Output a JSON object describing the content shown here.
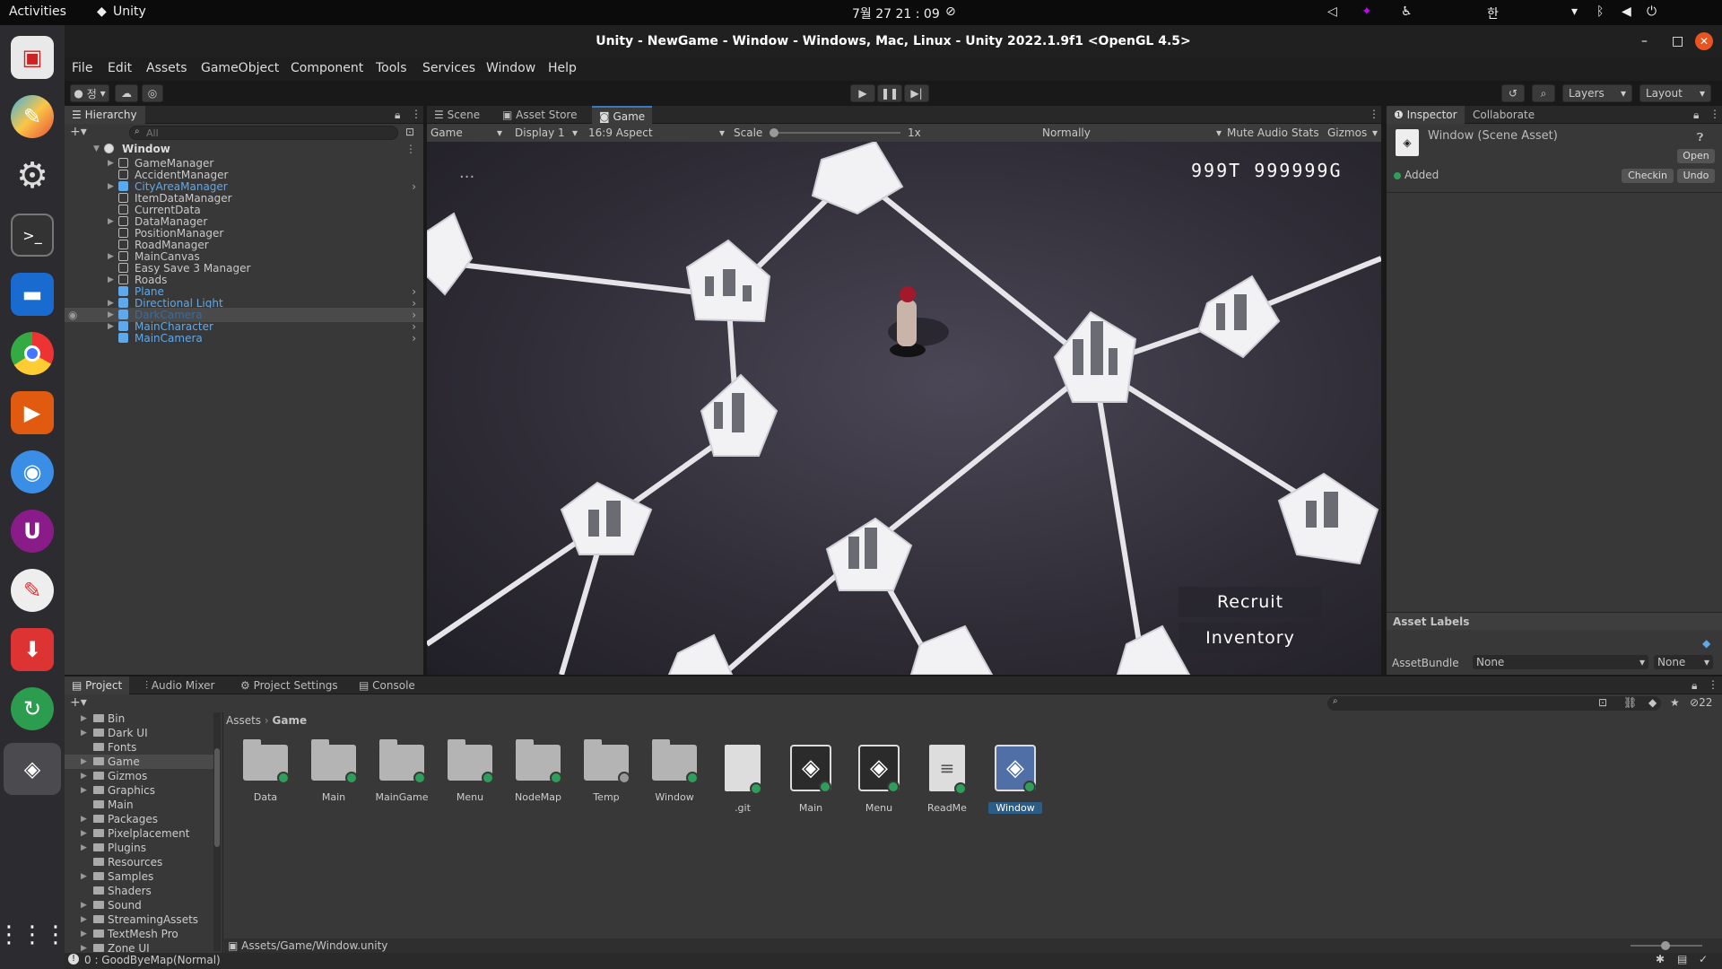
{
  "topbar": {
    "activities": "Activities",
    "app": "Unity",
    "clock": "7월 27 21 : 09",
    "ime": "한"
  },
  "window": {
    "title": "Unity - NewGame - Window - Windows, Mac, Linux - Unity 2022.1.9f1 <OpenGL 4.5>"
  },
  "menu": [
    "File",
    "Edit",
    "Assets",
    "GameObject",
    "Component",
    "Tools",
    "Services",
    "Window",
    "Help"
  ],
  "toolbar": {
    "account": "정",
    "layers": "Layers",
    "layout": "Layout"
  },
  "hierarchy": {
    "tab": "Hierarchy",
    "search_placeholder": "All",
    "root": "Window",
    "items": [
      {
        "label": "GameManager",
        "prefab": false,
        "arrow": true
      },
      {
        "label": "AccidentManager",
        "prefab": false,
        "arrow": false
      },
      {
        "label": "CityAreaManager",
        "prefab": true,
        "arrow": true
      },
      {
        "label": "ItemDataManager",
        "prefab": false,
        "arrow": false
      },
      {
        "label": "CurrentData",
        "prefab": false,
        "arrow": false
      },
      {
        "label": "DataManager",
        "prefab": false,
        "arrow": true
      },
      {
        "label": "PositionManager",
        "prefab": false,
        "arrow": false
      },
      {
        "label": "RoadManager",
        "prefab": false,
        "arrow": false
      },
      {
        "label": "MainCanvas",
        "prefab": false,
        "arrow": true
      },
      {
        "label": "Easy Save 3 Manager",
        "prefab": false,
        "arrow": false
      },
      {
        "label": "Roads",
        "prefab": false,
        "arrow": true
      },
      {
        "label": "Plane",
        "prefab": true,
        "arrow": false
      },
      {
        "label": "Directional Light",
        "prefab": true,
        "arrow": true
      },
      {
        "label": "DarkCamera",
        "prefab": true,
        "arrow": true,
        "selected": true,
        "dim": true
      },
      {
        "label": "MainCharacter",
        "prefab": true,
        "arrow": true
      },
      {
        "label": "MainCamera",
        "prefab": true,
        "arrow": false
      }
    ]
  },
  "scene": {
    "tabs": [
      "Scene",
      "Asset Store",
      "Game"
    ],
    "active_tab": "Game",
    "display_mode": "Game",
    "display": "Display 1",
    "aspect": "16:9 Aspect",
    "scale_label": "Scale",
    "scale_value": "1x",
    "play_mode": "Normally",
    "mute": "Mute Audio",
    "stats": "Stats",
    "gizmos": "Gizmos",
    "hud_resources": "999T  999999G",
    "recruit": "Recruit",
    "inventory": "Inventory",
    "dots": "..."
  },
  "inspector": {
    "tabs": [
      "Inspector",
      "Collaborate"
    ],
    "asset_name": "Window (Scene Asset)",
    "open": "Open",
    "status": "Added",
    "checkin": "Checkin",
    "undo": "Undo",
    "asset_labels": "Asset Labels",
    "assetbundle_label": "AssetBundle",
    "bundle_value": "None",
    "variant_value": "None"
  },
  "project": {
    "tabs": [
      "Project",
      "Audio Mixer",
      "Project Settings",
      "Console"
    ],
    "tree": [
      "Bin",
      "Dark UI",
      "Fonts",
      "Game",
      "Gizmos",
      "Graphics",
      "Main",
      "Packages",
      "Pixelplacement",
      "Plugins",
      "Resources",
      "Samples",
      "Shaders",
      "Sound",
      "StreamingAssets",
      "TextMesh Pro",
      "Zone UI"
    ],
    "breadcrumb": [
      "Assets",
      "Game"
    ],
    "assets": [
      {
        "name": "Data",
        "type": "folder"
      },
      {
        "name": "Main",
        "type": "folder"
      },
      {
        "name": "MainGame",
        "type": "folder"
      },
      {
        "name": "Menu",
        "type": "folder"
      },
      {
        "name": "NodeMap",
        "type": "folder"
      },
      {
        "name": "Temp",
        "type": "folder"
      },
      {
        "name": "Window",
        "type": "folder"
      },
      {
        "name": ".git",
        "type": "doc"
      },
      {
        "name": "Main",
        "type": "unity"
      },
      {
        "name": "Menu",
        "type": "unity"
      },
      {
        "name": "ReadMe",
        "type": "text"
      },
      {
        "name": "Window",
        "type": "unity",
        "selected": true
      }
    ],
    "path": "Assets/Game/Window.unity",
    "hidden_count": "22"
  },
  "status": {
    "message": "0 : GoodByeMap(Normal)"
  }
}
